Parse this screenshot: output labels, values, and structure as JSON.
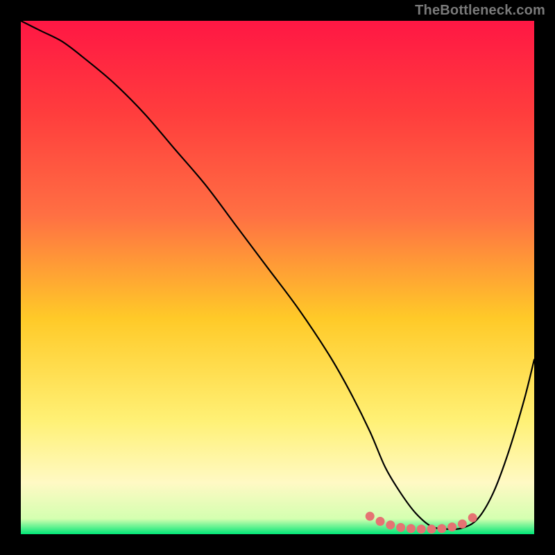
{
  "watermark": "TheBottleneck.com",
  "colors": {
    "bg": "#000000",
    "watermark": "#7a7a7a",
    "curve": "#000000",
    "dot_fill": "#e57373",
    "dot_stroke": "#e57373",
    "grad_top": "#ff1744",
    "grad_mid1": "#ff7043",
    "grad_mid2": "#ffca28",
    "grad_mid3": "#fff176",
    "grad_mid4": "#fff59d",
    "grad_bot_yellow": "#fff9c4",
    "grad_bot_green": "#00e676"
  },
  "chart_data": {
    "type": "line",
    "title": "",
    "xlabel": "",
    "ylabel": "",
    "xlim": [
      0,
      100
    ],
    "ylim": [
      0,
      100
    ],
    "grid": false,
    "series": [
      {
        "name": "bottleneck-curve",
        "x": [
          0,
          4,
          8,
          12,
          18,
          24,
          30,
          36,
          42,
          48,
          54,
          60,
          64,
          68,
          71,
          74,
          77,
          80,
          83,
          86,
          89,
          92,
          95,
          98,
          100
        ],
        "y": [
          100,
          98,
          96,
          93,
          88,
          82,
          75,
          68,
          60,
          52,
          44,
          35,
          28,
          20,
          13,
          8,
          4,
          1.5,
          1,
          1.2,
          3,
          8,
          16,
          26,
          34
        ]
      }
    ],
    "markers": {
      "name": "bottom-dots",
      "x": [
        68,
        70,
        72,
        74,
        76,
        78,
        80,
        82,
        84,
        86,
        88
      ],
      "y": [
        3.5,
        2.5,
        1.8,
        1.3,
        1.1,
        1.0,
        1.0,
        1.1,
        1.4,
        2.0,
        3.2
      ]
    }
  }
}
